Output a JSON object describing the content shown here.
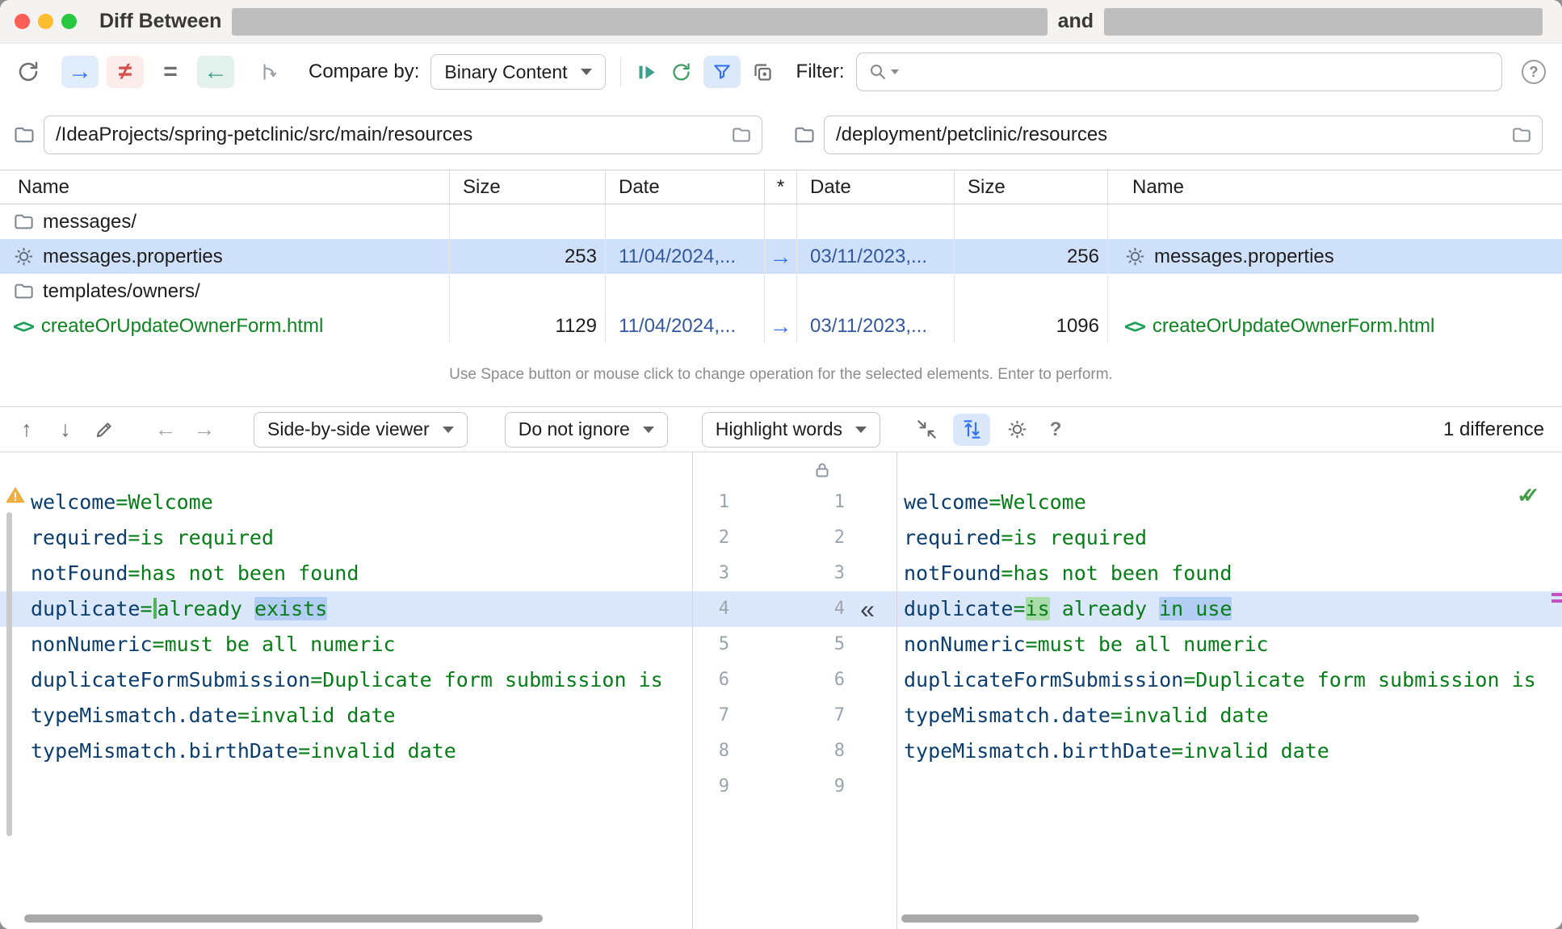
{
  "colors": {
    "accent_blue": "#3574F0",
    "neq_red": "#D5504A",
    "arrow_teal": "#3BA08B",
    "file_green": "#0E8420",
    "date_blue": "#33589E",
    "key_navy": "#0B3D6E",
    "value_green": "#067D17",
    "word_changed_bg": "#B3CDF5",
    "word_inserted_bg": "#AADCAA",
    "line_changed_bg": "#DBE7FA",
    "stripe_purple": "#C750C7"
  },
  "icons": {
    "arrow_right": "→",
    "arrow_left": "←",
    "not_equal": "≠",
    "equal": "=",
    "up": "↑",
    "down": "↓",
    "nav_left": "←",
    "nav_right": "→",
    "apply_left": "«",
    "help": "?",
    "double_check": "✓✓",
    "star": "*"
  },
  "window": {
    "title_prefix": "Diff Between",
    "title_conjunction": "and"
  },
  "toolbar": {
    "compare_by_label": "Compare by:",
    "compare_by_value": "Binary Content",
    "filter_label": "Filter:",
    "search_value": ""
  },
  "paths": {
    "left_value": "/IdeaProjects/spring-petclinic/src/main/resources",
    "right_value": "/deployment/petclinic/resources"
  },
  "table": {
    "headers": [
      "Name",
      "Size",
      "Date",
      "*",
      "Date",
      "Size",
      "Name"
    ],
    "rows": [
      {
        "icon": "folder",
        "name": "messages/"
      },
      {
        "icon": "gear",
        "name": "messages.properties",
        "size": "253",
        "date": "11/04/2024,...",
        "op": true,
        "rdate": "03/11/2023,...",
        "rsize": "256",
        "rname": "messages.properties",
        "ricon": "gear",
        "selected": true
      },
      {
        "icon": "folder",
        "name": "templates/owners/"
      },
      {
        "icon": "code",
        "name": "createOrUpdateOwnerForm.html",
        "size": "1129",
        "date": "11/04/2024,...",
        "op": true,
        "rdate": "03/11/2023,...",
        "rsize": "1096",
        "rname": "createOrUpdateOwnerForm.html",
        "ricon": "code",
        "green": true
      }
    ],
    "hint": "Use Space button or mouse click to change operation for the selected elements. Enter to perform."
  },
  "diff_toolbar": {
    "viewer_select": "Side-by-side viewer",
    "ignore_select": "Do not ignore",
    "highlight_select": "Highlight words",
    "status": "1 difference"
  },
  "diff": {
    "left_line_numbers": [
      "1",
      "2",
      "3",
      "4",
      "5",
      "6",
      "7",
      "8",
      "9"
    ],
    "right_line_numbers": [
      "1",
      "2",
      "3",
      "4",
      "5",
      "6",
      "7",
      "8",
      "9"
    ],
    "changed_line": 4,
    "left_lines": [
      {
        "segs": [
          [
            "key",
            "welcome"
          ],
          [
            "val",
            "=Welcome"
          ]
        ]
      },
      {
        "segs": [
          [
            "key",
            "required"
          ],
          [
            "val",
            "=is required"
          ]
        ]
      },
      {
        "segs": [
          [
            "key",
            "notFound"
          ],
          [
            "val",
            "=has not been found"
          ]
        ]
      },
      {
        "changed": true,
        "segs": [
          [
            "key",
            "duplicate"
          ],
          [
            "val",
            "="
          ],
          [
            "ins",
            ""
          ],
          [
            "val",
            "already "
          ],
          [
            "chg",
            "exists"
          ]
        ]
      },
      {
        "segs": [
          [
            "key",
            "nonNumeric"
          ],
          [
            "val",
            "=must be all numeric"
          ]
        ]
      },
      {
        "segs": [
          [
            "key",
            "duplicateFormSubmission"
          ],
          [
            "val",
            "=Duplicate form submission is"
          ]
        ]
      },
      {
        "segs": [
          [
            "key",
            "typeMismatch.date"
          ],
          [
            "val",
            "=invalid date"
          ]
        ]
      },
      {
        "segs": [
          [
            "key",
            "typeMismatch.birthDate"
          ],
          [
            "val",
            "=invalid date"
          ]
        ]
      }
    ],
    "right_lines": [
      {
        "segs": [
          [
            "key",
            "welcome"
          ],
          [
            "val",
            "=Welcome"
          ]
        ]
      },
      {
        "segs": [
          [
            "key",
            "required"
          ],
          [
            "val",
            "=is required"
          ]
        ]
      },
      {
        "segs": [
          [
            "key",
            "notFound"
          ],
          [
            "val",
            "=has not been found"
          ]
        ]
      },
      {
        "changed": true,
        "segs": [
          [
            "key",
            "duplicate"
          ],
          [
            "val",
            "="
          ],
          [
            "new",
            "is"
          ],
          [
            "val",
            " already "
          ],
          [
            "chg",
            "in use"
          ]
        ]
      },
      {
        "segs": [
          [
            "key",
            "nonNumeric"
          ],
          [
            "val",
            "=must be all numeric"
          ]
        ]
      },
      {
        "segs": [
          [
            "key",
            "duplicateFormSubmission"
          ],
          [
            "val",
            "=Duplicate form submission is"
          ]
        ]
      },
      {
        "segs": [
          [
            "key",
            "typeMismatch.date"
          ],
          [
            "val",
            "=invalid date"
          ]
        ]
      },
      {
        "segs": [
          [
            "key",
            "typeMismatch.birthDate"
          ],
          [
            "val",
            "=invalid date"
          ]
        ]
      }
    ]
  }
}
